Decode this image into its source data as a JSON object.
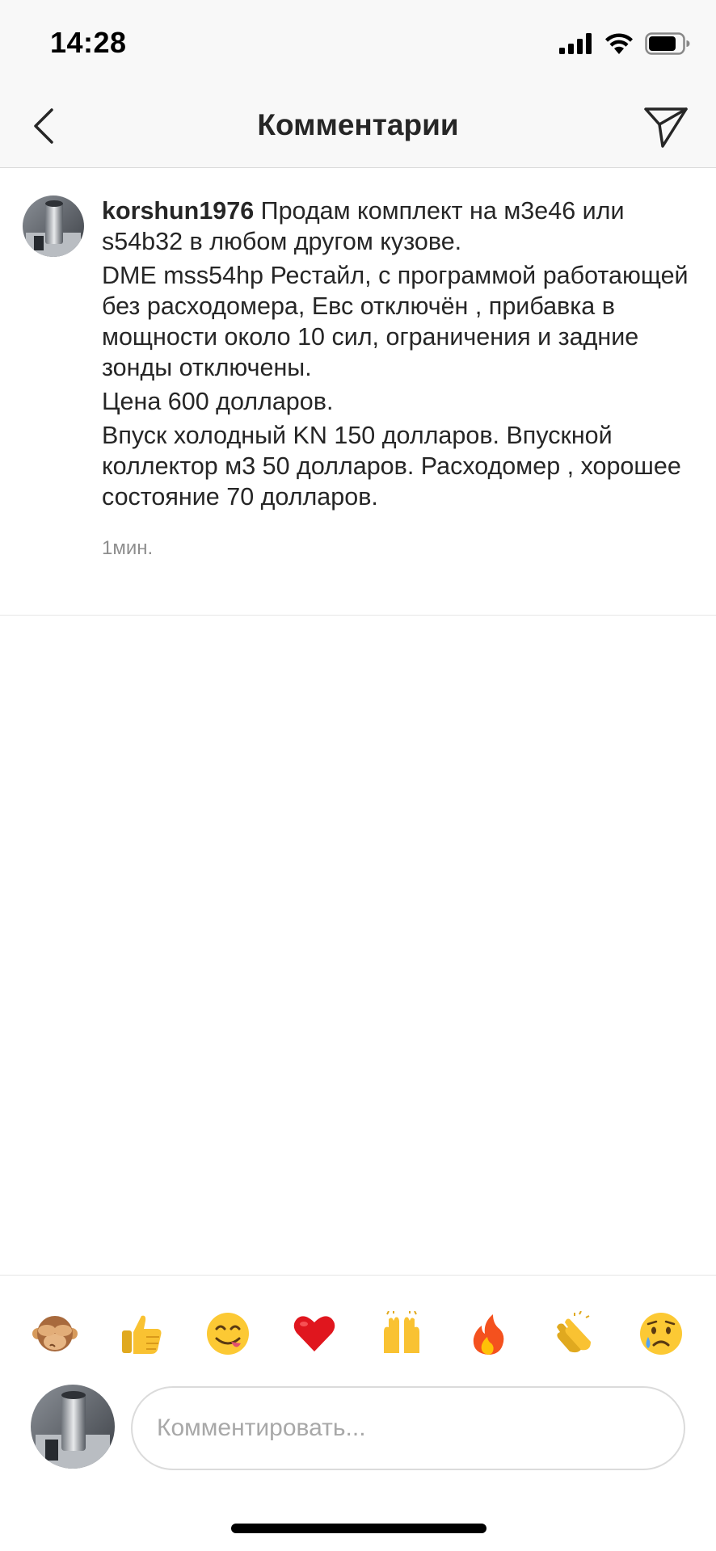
{
  "status_bar": {
    "time": "14:28"
  },
  "nav": {
    "title": "Комментарии"
  },
  "comment": {
    "username": "korshun1976",
    "text_line1": "Продам комплект на м3е46 или s54b32 в любом другом кузове.",
    "text_line2": "DME mss54hp Рестайл, с программой работающей без расходомера, Евс отключён , прибавка в мощности около 10 сил, ограничения и задние зонды отключены.",
    "text_line3": "Цена 600 долларов.",
    "text_line4": "Впуск холодный KN 150 долларов.  Впускной коллектор м3 50 долларов. Расходомер , хорошее состояние 70 долларов.",
    "timestamp": "1мин."
  },
  "emoji_bar": {
    "emojis": [
      "🙈",
      "👍",
      "😋",
      "❤️",
      "🙌",
      "🔥",
      "👏",
      "😢"
    ]
  },
  "composer": {
    "placeholder": "Комментировать..."
  }
}
